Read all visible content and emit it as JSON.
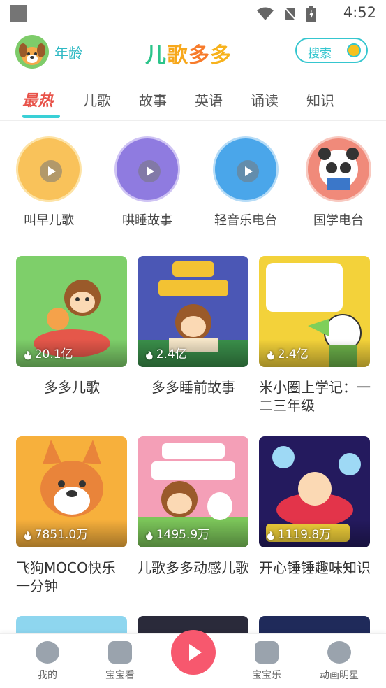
{
  "status_bar": {
    "time": "4:52"
  },
  "app_bar": {
    "age_label": "年龄",
    "logo_text": "儿歌多多",
    "search_label": "搜索"
  },
  "tabs": [
    {
      "label": "最热",
      "active": true
    },
    {
      "label": "儿歌",
      "active": false
    },
    {
      "label": "故事",
      "active": false
    },
    {
      "label": "英语",
      "active": false
    },
    {
      "label": "诵读",
      "active": false
    },
    {
      "label": "知识",
      "active": false
    }
  ],
  "channels": [
    {
      "label": "叫早儿歌",
      "icon": "bunny-music-icon",
      "color": "#f9c25a"
    },
    {
      "label": "哄睡故事",
      "icon": "moon-sleep-icon",
      "color": "#8f7be0"
    },
    {
      "label": "轻音乐电台",
      "icon": "gramophone-icon",
      "color": "#4aa6ea"
    },
    {
      "label": "国学电台",
      "icon": "panda-book-icon",
      "color": "#f08a7a"
    }
  ],
  "cards": [
    {
      "title": "多多儿歌",
      "count": "20.1亿",
      "bg": "#7ecf6a"
    },
    {
      "title": "多多睡前故事",
      "count": "2.4亿",
      "bg": "#4b57b5"
    },
    {
      "title": "米小圈上学记：一二三年级",
      "count": "2.4亿",
      "bg": "#f3d23a"
    },
    {
      "title": "飞狗MOCO快乐一分钟",
      "count": "7851.0万",
      "bg": "#f7b03c"
    },
    {
      "title": "儿歌多多动感儿歌",
      "count": "1495.9万",
      "bg": "#f49fb7"
    },
    {
      "title": "开心锤锤趣味知识",
      "count": "1119.8万",
      "bg": "#241a5e"
    }
  ],
  "bottom_nav": [
    {
      "label": "我的",
      "icon": "monkey-face-icon"
    },
    {
      "label": "宝宝看",
      "icon": "tv-play-icon"
    },
    {
      "label": "",
      "icon": "play-icon"
    },
    {
      "label": "宝宝乐",
      "icon": "puzzle-icon"
    },
    {
      "label": "动画明星",
      "icon": "star-bear-icon"
    }
  ],
  "colors": {
    "accent": "#35c6cf",
    "active_tab": "#e8534a",
    "play": "#f7586e"
  }
}
